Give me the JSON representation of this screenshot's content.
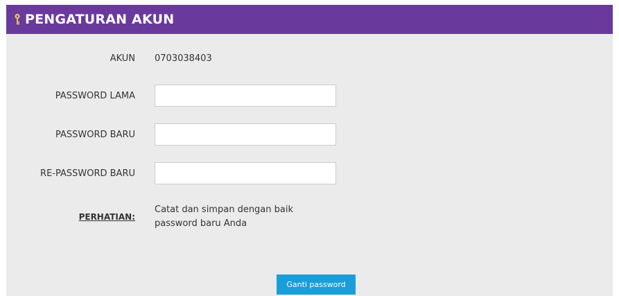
{
  "header": {
    "title": "PENGATURAN AKUN",
    "icon": "key-icon",
    "background_color": "#693a9b",
    "icon_color": "#e8c25a"
  },
  "form": {
    "account_label": "AKUN",
    "account_value": "0703038403",
    "old_password_label": "PASSWORD LAMA",
    "old_password_value": "",
    "new_password_label": "PASSWORD BARU",
    "new_password_value": "",
    "repeat_password_label": "RE-PASSWORD BARU",
    "repeat_password_value": ""
  },
  "notice": {
    "label": "PERHATIAN:",
    "text": "Catat dan simpan dengan baik password baru Anda"
  },
  "actions": {
    "submit_label": "Ganti password",
    "submit_color": "#1a9ed9"
  }
}
